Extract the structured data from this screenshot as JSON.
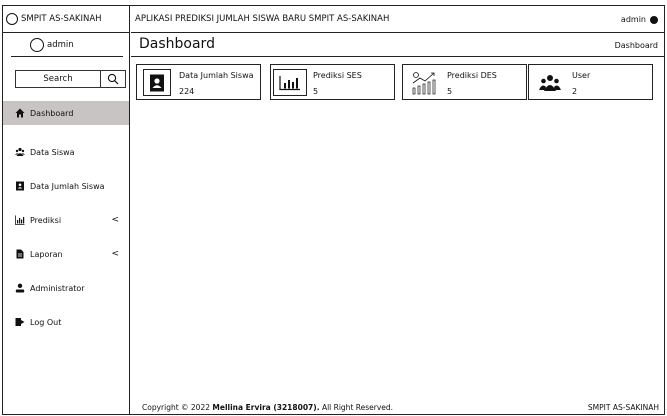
{
  "sidebar": {
    "brand": "SMPIT AS-SAKINAH",
    "user": "admin",
    "search_label": "Search",
    "items": [
      {
        "label": "Dashboard",
        "icon": "home-icon",
        "caret": ""
      },
      {
        "label": "Data Siswa",
        "icon": "users-icon",
        "caret": ""
      },
      {
        "label": "Data Jumlah Siswa",
        "icon": "contact-book-icon",
        "caret": ""
      },
      {
        "label": "Prediksi",
        "icon": "bar-chart-icon",
        "caret": "<"
      },
      {
        "label": "Laporan",
        "icon": "document-icon",
        "caret": "<"
      },
      {
        "label": "Administrator",
        "icon": "user-icon",
        "caret": ""
      },
      {
        "label": "Log Out",
        "icon": "logout-icon",
        "caret": ""
      }
    ]
  },
  "topbar": {
    "title": "APLIKASI PREDIKSI JUMLAH SISWA BARU SMPIT AS-SAKINAH",
    "user": "admin"
  },
  "page": {
    "title": "Dashboard",
    "breadcrumb": "Dashboard"
  },
  "cards": [
    {
      "label": "Data Jumlah Siswa",
      "value": "224",
      "icon": "contact-book-icon"
    },
    {
      "label": "Prediksi SES",
      "value": "5",
      "icon": "bar-chart-icon"
    },
    {
      "label": "Prediksi DES",
      "value": "5",
      "icon": "growth-chart-icon"
    },
    {
      "label": "User",
      "value": "2",
      "icon": "users-icon"
    }
  ],
  "footer": {
    "prefix": "Copyright © 2022 ",
    "author": "Mellina Ervira (3218007).",
    "suffix": " All Right Reserved.",
    "right": "SMPIT AS-SAKINAH"
  }
}
